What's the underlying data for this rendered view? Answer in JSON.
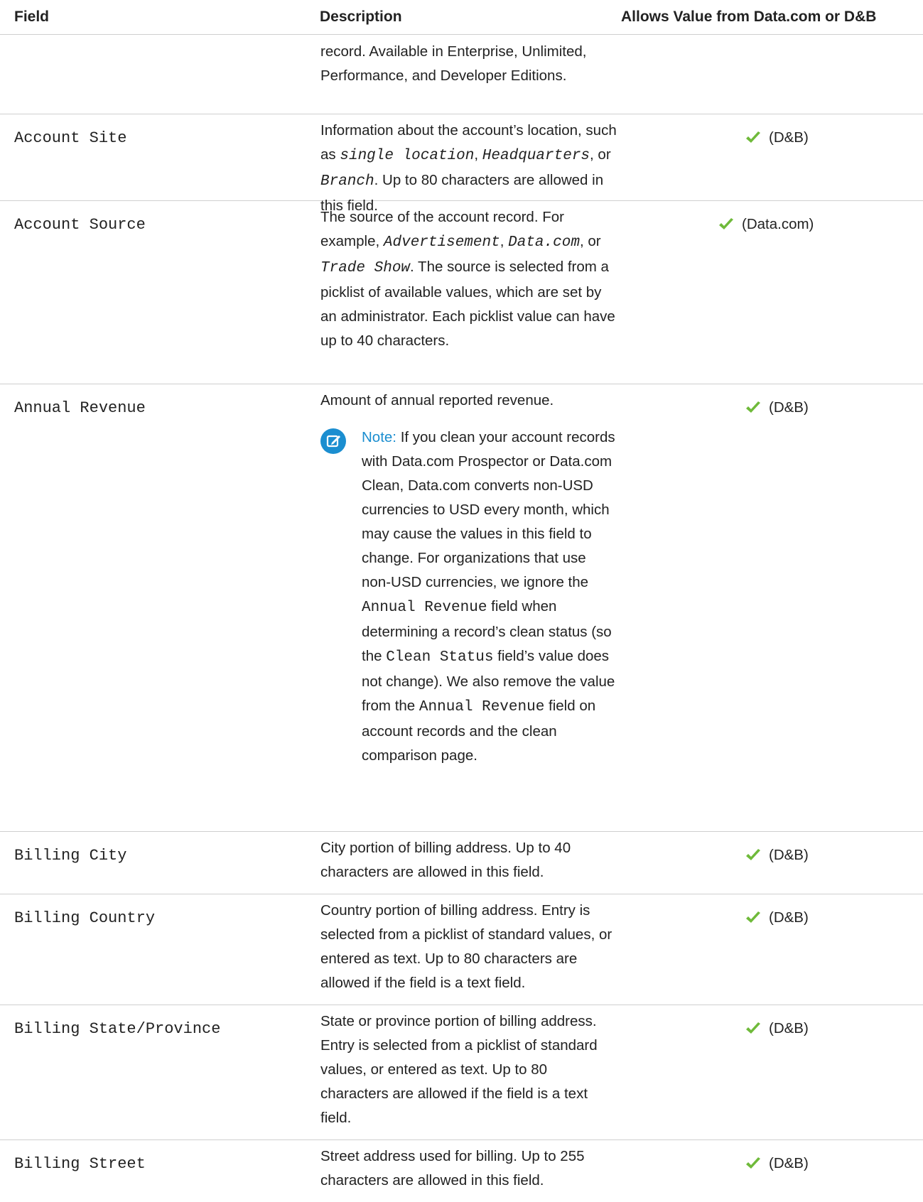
{
  "header": {
    "field": "Field",
    "description": "Description",
    "allows": "Allows Value from Data.com or D&B"
  },
  "colors": {
    "check": "#6fba3a",
    "note_accent": "#1b8ed0",
    "rule": "#cfcfcf"
  },
  "rows": [
    {
      "field": "",
      "description": "record. Available in Enterprise, Unlimited, Performance, and Developer Editions.",
      "allows": ""
    },
    {
      "field": "Account Site",
      "description": {
        "t1": "Information about the account’s location, such as ",
        "c1": "single location",
        "t2": ", ",
        "c2": "Headquarters",
        "t3": ", or ",
        "c3": "Branch",
        "t4": ". Up to 80 characters are allowed in this field."
      },
      "allows": "(D&B)",
      "check_icon": "checkmark-icon"
    },
    {
      "field": "Account Source",
      "description": {
        "t1": "The source of the account record. For example, ",
        "c1": "Advertisement",
        "t2": ", ",
        "c2": "Data.com",
        "t3": ", or ",
        "c3": "Trade Show",
        "t4": ". The source is selected from a picklist of available values, which are set by an administrator. Each picklist value can have up to 40 characters."
      },
      "allows": "(Data.com)",
      "check_icon": "checkmark-icon"
    },
    {
      "field": "Annual Revenue",
      "description": "Amount of annual reported revenue.",
      "note": {
        "label": "Note:",
        "t1": " If you clean your account records with Data.com Prospector or Data.com Clean, Data.com converts non-USD currencies to USD every month, which may cause the values in this field to change. For organizations that use non-USD currencies, we ignore the ",
        "c1": "Annual Revenue",
        "t2": " field when determining a record’s clean status (so the ",
        "c2": "Clean Status",
        "t3": " field’s value does not change). We also remove the value from the ",
        "c3": "Annual Revenue",
        "t4": " field on account records and the clean comparison page.",
        "icon": "note-edit-icon"
      },
      "allows": "(D&B)",
      "check_icon": "checkmark-icon"
    },
    {
      "field": "Billing City",
      "description": "City portion of billing address. Up to 40 characters are allowed in this field.",
      "allows": "(D&B)",
      "check_icon": "checkmark-icon"
    },
    {
      "field": "Billing Country",
      "description": "Country portion of billing address. Entry is selected from a picklist of standard values, or entered as text. Up to 80 characters are allowed if the field is a text field.",
      "allows": "(D&B)",
      "check_icon": "checkmark-icon"
    },
    {
      "field": "Billing State/Province",
      "description": "State or province portion of billing address. Entry is selected from a picklist of standard values, or entered as text. Up to 80 characters are allowed if the field is a text field.",
      "allows": "(D&B)",
      "check_icon": "checkmark-icon"
    },
    {
      "field": "Billing Street",
      "description": "Street address used for billing. Up to 255 characters are allowed in this field.",
      "allows": "(D&B)",
      "check_icon": "checkmark-icon"
    }
  ]
}
